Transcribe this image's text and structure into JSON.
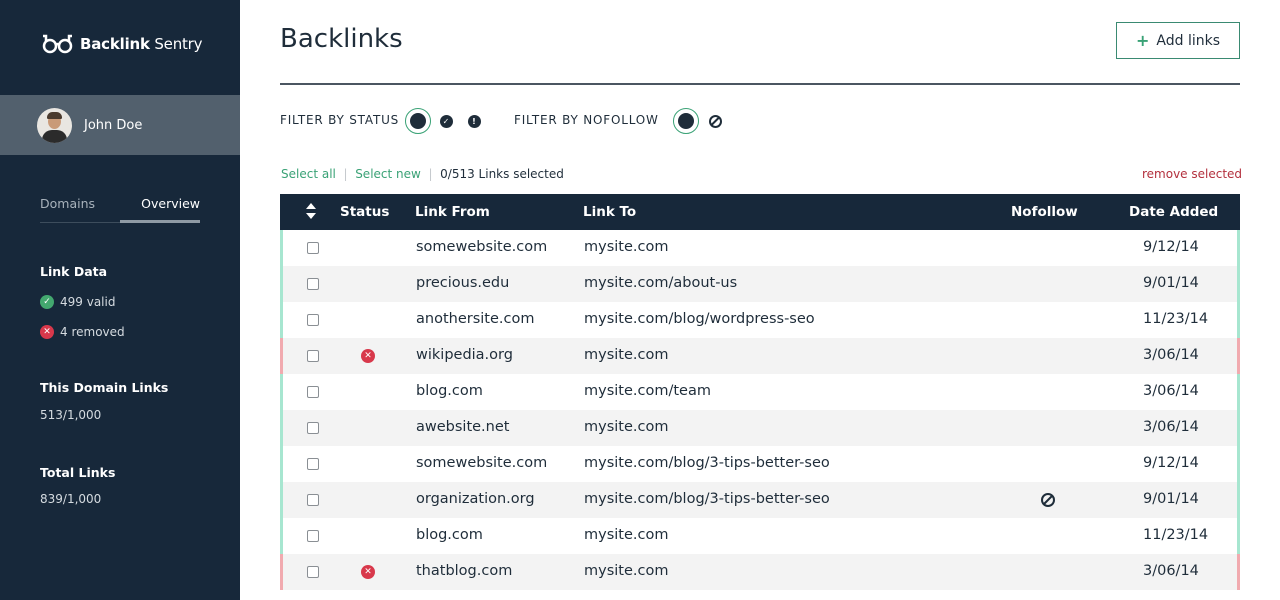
{
  "app": {
    "brand_bold": "Backlink",
    "brand_light": "Sentry"
  },
  "user": {
    "name": "John Doe"
  },
  "sidebar": {
    "tabs": [
      {
        "label": "Domains",
        "active": false
      },
      {
        "label": "Overview",
        "active": true
      }
    ],
    "link_data": {
      "title": "Link Data",
      "valid": "499 valid",
      "removed": "4 removed"
    },
    "domain_links": {
      "title": "This Domain Links",
      "value": "513/1,000"
    },
    "total_links": {
      "title": "Total Links",
      "value": "839/1,000"
    }
  },
  "page": {
    "title": "Backlinks",
    "add_button": "Add links"
  },
  "filters": {
    "status_label": "FILTER BY STATUS",
    "nofollow_label": "FILTER BY NOFOLLOW"
  },
  "selection": {
    "select_all": "Select all",
    "select_new": "Select new",
    "count": "0/513 Links selected",
    "remove": "remove selected"
  },
  "table": {
    "headers": {
      "status": "Status",
      "link_from": "Link From",
      "link_to": "Link To",
      "nofollow": "Nofollow",
      "date_added": "Date Added"
    },
    "rows": [
      {
        "from": "somewebsite.com",
        "to": "mysite.com",
        "date": "9/12/14",
        "removed": false,
        "nofollow": false
      },
      {
        "from": "precious.edu",
        "to": "mysite.com/about-us",
        "date": "9/01/14",
        "removed": false,
        "nofollow": false
      },
      {
        "from": "anothersite.com",
        "to": "mysite.com/blog/wordpress-seo",
        "date": "11/23/14",
        "removed": false,
        "nofollow": false
      },
      {
        "from": "wikipedia.org",
        "to": "mysite.com",
        "date": "3/06/14",
        "removed": true,
        "nofollow": false
      },
      {
        "from": "blog.com",
        "to": "mysite.com/team",
        "date": "3/06/14",
        "removed": false,
        "nofollow": false
      },
      {
        "from": "awebsite.net",
        "to": "mysite.com",
        "date": "3/06/14",
        "removed": false,
        "nofollow": false
      },
      {
        "from": "somewebsite.com",
        "to": "mysite.com/blog/3-tips-better-seo",
        "date": "9/12/14",
        "removed": false,
        "nofollow": false
      },
      {
        "from": "organization.org",
        "to": "mysite.com/blog/3-tips-better-seo",
        "date": "9/01/14",
        "removed": false,
        "nofollow": true
      },
      {
        "from": "blog.com",
        "to": "mysite.com",
        "date": "11/23/14",
        "removed": false,
        "nofollow": false
      },
      {
        "from": "thatblog.com",
        "to": "mysite.com",
        "date": "3/06/14",
        "removed": true,
        "nofollow": false
      }
    ]
  },
  "colors": {
    "sidebar": "#17283a",
    "accent": "#3aa276",
    "danger": "#d8384b",
    "valid_border": "#a7e6d0",
    "removed_border": "#f1aaaf"
  }
}
